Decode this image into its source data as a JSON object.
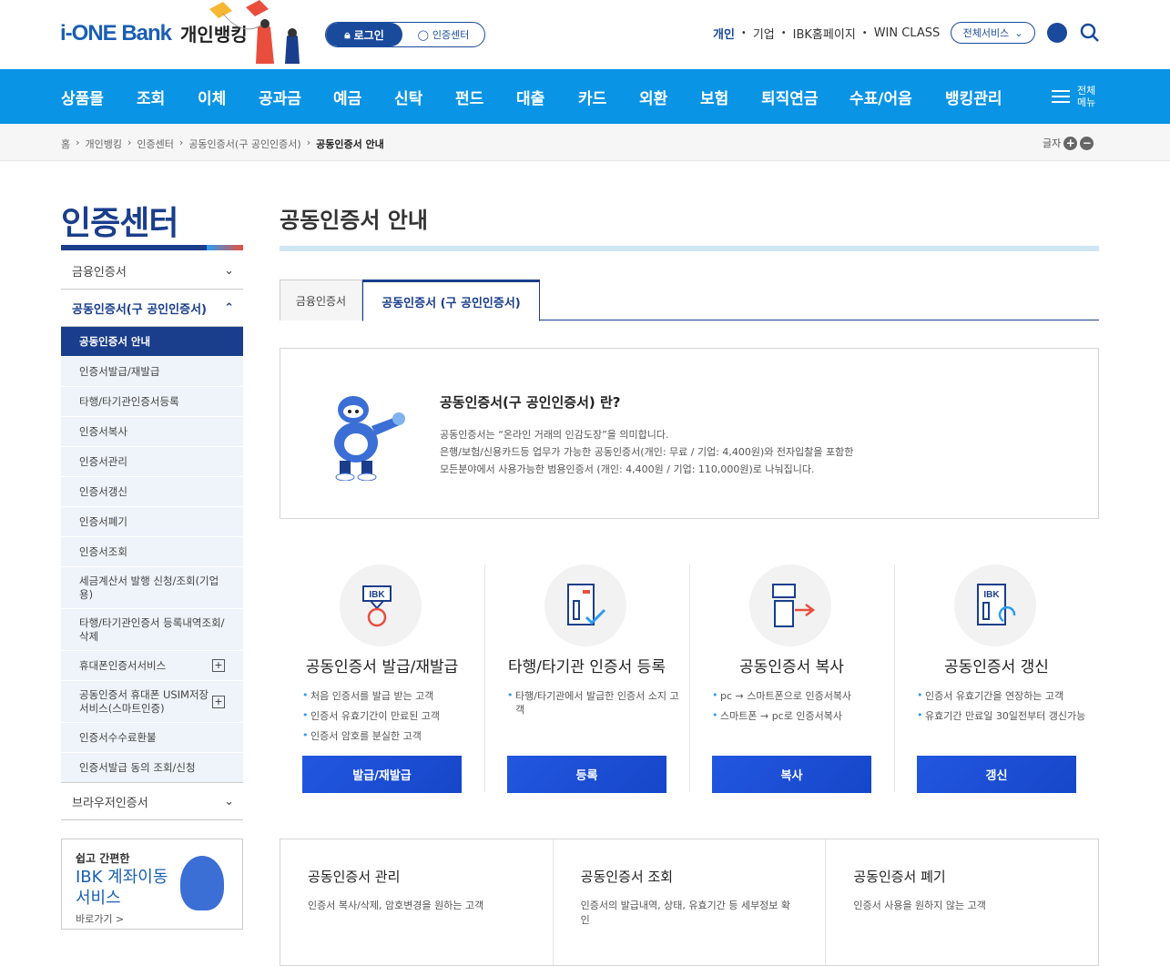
{
  "header": {
    "logo_main": "i-ONE Bank",
    "logo_sub": "개인뱅킹",
    "login_label": "로그인",
    "cert_center_label": "인증센터",
    "top_links": [
      "개인",
      "기업",
      "IBK홈페이지",
      "WIN CLASS"
    ],
    "all_services_label": "전체서비스"
  },
  "gnb": {
    "items": [
      "상품몰",
      "조회",
      "이체",
      "공과금",
      "예금",
      "신탁",
      "펀드",
      "대출",
      "카드",
      "외환",
      "보험",
      "퇴직연금",
      "수표/어음",
      "뱅킹관리"
    ],
    "full_menu_line1": "전체",
    "full_menu_line2": "메뉴"
  },
  "breadcrumb": {
    "items": [
      "홈",
      "개인뱅킹",
      "인증센터",
      "공동인증서(구 공인인증서)",
      "공동인증서 안내"
    ],
    "font_label": "글자",
    "font_plus": "+",
    "font_minus": "−"
  },
  "lnb": {
    "title": "인증센터",
    "d1_financial": "금융인증서",
    "d1_joint": "공동인증서(구 공인인증서)",
    "d2": [
      "공동인증서 안내",
      "인증서발급/재발급",
      "타행/타기관인증서등록",
      "인증서복사",
      "인증서관리",
      "인증서갱신",
      "인증서폐기",
      "인증서조회",
      "세금계산서 발행 신청/조회(기업용)",
      "타행/타기관인증서 등록내역조회/삭제",
      "휴대폰인증서서비스",
      "공동인증서 휴대폰 USIM저장서비스(스마트인증)",
      "인증서수수료환불",
      "인증서발급 동의 조회/신청"
    ],
    "d1_browser": "브라우저인증서"
  },
  "banner": {
    "line1": "쉽고 간편한",
    "line2": "IBK 계좌이동",
    "line3": "서비스",
    "link": "바로가기 >"
  },
  "content": {
    "title": "공동인증서 안내",
    "tab_financial": "금융인증서",
    "tab_joint": "공동인증서 (구 공인인증서)",
    "intro_title": "공동인증서(구 공인인증서) 란?",
    "intro_line1": "공동인증서는 “온라인 거래의 인감도장”을 의미합니다.",
    "intro_line2": "은행/보험/신용카드등 업무가 가능한 공동인증서(개인: 무료 / 기업: 4,400원)와 전자입찰을 포함한",
    "intro_line3": "모든분야에서 사용가능한 범용인증서 (개인: 4,400원 / 기업: 110,000원)로 나눠집니다."
  },
  "services": [
    {
      "title": "공동인증서 발급/재발급",
      "items": [
        "처음 인증서를 발급 받는 고객",
        "인증서 유효기간이 만료된 고객",
        "인증서 암호를 분실한 고객"
      ],
      "button": "발급/재발급",
      "icon": "issue-icon"
    },
    {
      "title": "타행/타기관 인증서 등록",
      "items": [
        "타행/타기관에서 발급한 인증서 소지 고객"
      ],
      "button": "등록",
      "icon": "register-icon"
    },
    {
      "title": "공동인증서 복사",
      "items": [
        "pc → 스마트폰으로 인증서복사",
        "스마트폰 → pc로 인증서복사"
      ],
      "button": "복사",
      "icon": "copy-icon"
    },
    {
      "title": "공동인증서 갱신",
      "items": [
        "인증서 유효기간을 연장하는 고객",
        "유효기간 만료일 30일전부터 갱신가능"
      ],
      "button": "갱신",
      "icon": "renew-icon"
    }
  ],
  "bottom": [
    {
      "title": "공동인증서 관리",
      "desc": "인증서 복사/삭제, 암호변경을 원하는 고객"
    },
    {
      "title": "공동인증서 조회",
      "desc": "인증서의 발급내역, 상태, 유효기간 등 세부정보 확인"
    },
    {
      "title": "공동인증서 폐기",
      "desc": "인증서 사용을 원하지 않는 고객"
    }
  ]
}
